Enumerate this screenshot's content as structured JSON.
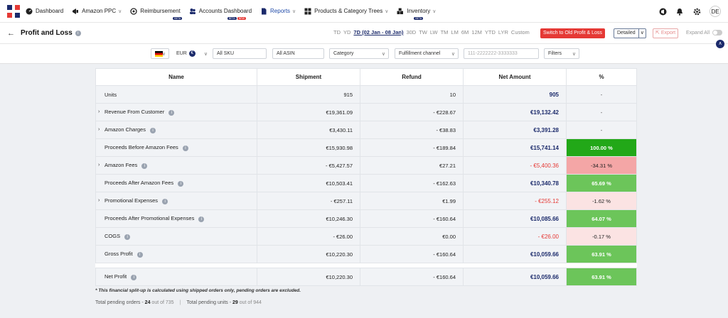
{
  "nav": {
    "items": [
      {
        "label": "Dashboard",
        "icon": "speedometer-icon"
      },
      {
        "label": "Amazon PPC",
        "icon": "megaphone-icon"
      },
      {
        "label": "Reimbursement",
        "icon": "refund-icon",
        "badge": "BETA"
      },
      {
        "label": "Accounts Dashboard",
        "icon": "users-icon",
        "badge": "NEW"
      },
      {
        "label": "Reports",
        "icon": "document-icon"
      },
      {
        "label": "Products & Category Trees",
        "icon": "grid-icon"
      },
      {
        "label": "Inventory",
        "icon": "boxes-icon",
        "badge": "BETA"
      }
    ],
    "user_initials": "DE"
  },
  "header": {
    "title": "Profit and Loss",
    "ranges": [
      "TD",
      "YD",
      "7D (02 Jan - 08 Jan)",
      "30D",
      "TW",
      "LW",
      "TM",
      "LM",
      "6M",
      "12M",
      "YTD",
      "LYR",
      "Custom"
    ],
    "selected_range": "7D (02 Jan - 08 Jan)",
    "switch_label": "Switch to Old Profit & Loss",
    "view_label": "Detailed",
    "export_label": "Export",
    "expand_label": "Expand All"
  },
  "filters": {
    "currency": "EUR",
    "sku": "All SKU",
    "asin": "All ASIN",
    "category": "Category",
    "fulfillment": "Fulfillment channel",
    "phone_placeholder": "111-2222222-3333333",
    "filters_label": "Filters"
  },
  "table": {
    "columns": [
      "Name",
      "Shipment",
      "Refund",
      "Net Amount",
      "%"
    ],
    "rows": [
      {
        "name": "Units",
        "shipment": "915",
        "refund": "10",
        "net": "905",
        "pct": "-",
        "expandable": false,
        "info": false,
        "pct_style": "none",
        "net_neg": false
      },
      {
        "name": "Revenue From Customer",
        "shipment": "€19,361.09",
        "refund": "- €228.67",
        "net": "€19,132.42",
        "pct": "-",
        "expandable": true,
        "info": true,
        "pct_style": "none",
        "net_neg": false
      },
      {
        "name": "Amazon Charges",
        "shipment": "€3,430.11",
        "refund": "- €38.83",
        "net": "€3,391.28",
        "pct": "-",
        "expandable": true,
        "info": true,
        "pct_style": "none",
        "net_neg": false
      },
      {
        "name": "Proceeds Before Amazon Fees",
        "shipment": "€15,930.98",
        "refund": "- €189.84",
        "net": "€15,741.14",
        "pct": "100.00 %",
        "expandable": false,
        "info": true,
        "pct_style": "dkgreen",
        "net_neg": false
      },
      {
        "name": "Amazon Fees",
        "shipment": "- €5,427.57",
        "refund": "€27.21",
        "net": "- €5,400.36",
        "pct": "-34.31 %",
        "expandable": true,
        "info": true,
        "pct_style": "red",
        "net_neg": true
      },
      {
        "name": "Proceeds After Amazon Fees",
        "shipment": "€10,503.41",
        "refund": "- €162.63",
        "net": "€10,340.78",
        "pct": "65.69 %",
        "expandable": false,
        "info": true,
        "pct_style": "green",
        "net_neg": false
      },
      {
        "name": "Promotional Expenses",
        "shipment": "- €257.11",
        "refund": "€1.99",
        "net": "- €255.12",
        "pct": "-1.62 %",
        "expandable": true,
        "info": true,
        "pct_style": "pink",
        "net_neg": true
      },
      {
        "name": "Proceeds After Promotional Expenses",
        "shipment": "€10,246.30",
        "refund": "- €160.64",
        "net": "€10,085.66",
        "pct": "64.07 %",
        "expandable": false,
        "info": true,
        "pct_style": "green",
        "net_neg": false
      },
      {
        "name": "COGS",
        "shipment": "- €26.00",
        "refund": "€0.00",
        "net": "- €26.00",
        "pct": "-0.17 %",
        "expandable": false,
        "info": true,
        "pct_style": "pink",
        "net_neg": true
      },
      {
        "name": "Gross Profit",
        "shipment": "€10,220.30",
        "refund": "- €160.64",
        "net": "€10,059.66",
        "pct": "63.91 %",
        "expandable": false,
        "info": true,
        "pct_style": "green",
        "net_neg": false
      }
    ],
    "net_profit": {
      "name": "Net Profit",
      "shipment": "€10,220.30",
      "refund": "- €160.64",
      "net": "€10,059.66",
      "pct": "63.91 %"
    }
  },
  "footer": {
    "note": "* This financial split-up is calculated using shipped orders only, pending orders are excluded.",
    "pending_orders_label": "Total pending orders -",
    "pending_orders": "24",
    "pending_orders_total": "out of 735",
    "pending_units_label": "Total pending units -",
    "pending_units": "29",
    "pending_units_total": "out of 944"
  }
}
